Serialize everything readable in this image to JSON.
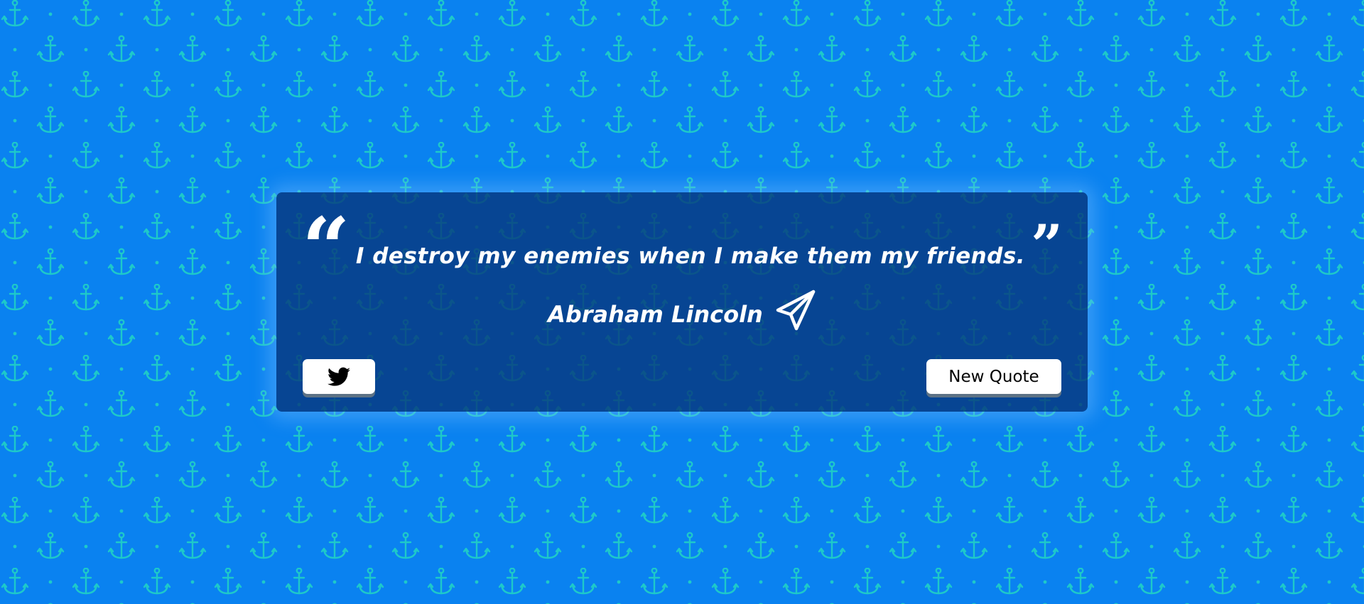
{
  "page": {
    "background_color": "#0a82f0",
    "pattern_color": "#1ec9c9",
    "pattern_icon": "anchor-icon"
  },
  "quote": {
    "text": "I destroy my enemies when I make them my friends.",
    "open_mark": "“",
    "close_mark": "”",
    "author": "Abraham Lincoln",
    "author_icon": "paper-plane-icon"
  },
  "actions": {
    "tweet_icon": "twitter-icon",
    "new_quote_label": "New Quote"
  }
}
